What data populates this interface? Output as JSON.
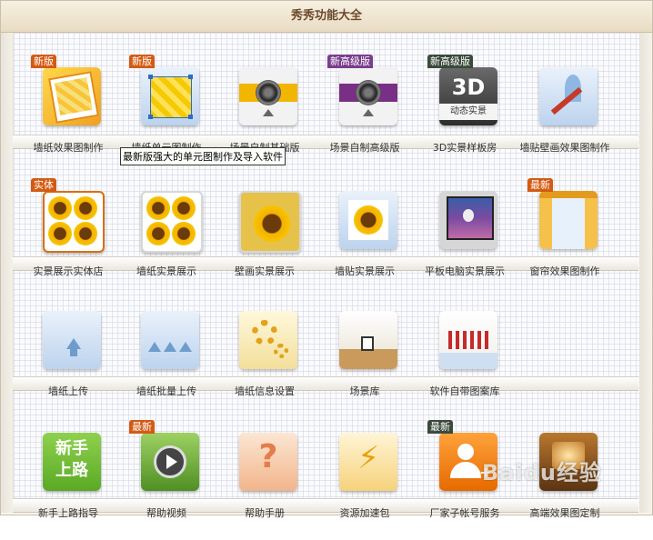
{
  "window": {
    "title": "秀秀功能大全"
  },
  "rows": [
    [
      {
        "label": "墙纸效果图制作",
        "badge": "新版",
        "icon": "wallpaper-effect-icon"
      },
      {
        "label": "墙纸单元图制作",
        "badge": "新版",
        "icon": "wallpaper-unit-icon"
      },
      {
        "label": "场景自制基础版",
        "badge": "",
        "icon": "scene-camera-basic-icon"
      },
      {
        "label": "场景自制高级版",
        "badge": "新高级版",
        "icon": "scene-camera-advanced-icon"
      },
      {
        "label": "3D实景样板房",
        "badge": "新高级版",
        "icon": "3d-showroom-icon"
      },
      {
        "label": "墙贴壁画效果图制作",
        "badge": "",
        "icon": "wall-mural-icon"
      }
    ],
    [
      {
        "label": "实景展示实体店",
        "badge": "实体",
        "icon": "store-display-icon"
      },
      {
        "label": "墙纸实景展示",
        "badge": "",
        "icon": "wallpaper-display-icon"
      },
      {
        "label": "壁画实景展示",
        "badge": "",
        "icon": "mural-display-icon"
      },
      {
        "label": "墙贴实景展示",
        "badge": "",
        "icon": "sticker-display-icon"
      },
      {
        "label": "平板电脑实景展示",
        "badge": "",
        "icon": "tablet-display-icon"
      },
      {
        "label": "窗帘效果图制作",
        "badge": "最新",
        "icon": "curtain-effect-icon"
      }
    ],
    [
      {
        "label": "墙纸上传",
        "badge": "",
        "icon": "wallpaper-upload-icon"
      },
      {
        "label": "墙纸批量上传",
        "badge": "",
        "icon": "batch-upload-icon"
      },
      {
        "label": "墙纸信息设置",
        "badge": "",
        "icon": "settings-gear-icon"
      },
      {
        "label": "场景库",
        "badge": "",
        "icon": "scene-library-icon"
      },
      {
        "label": "软件自带图案库",
        "badge": "",
        "icon": "pattern-library-icon"
      }
    ],
    [
      {
        "label": "新手上路指导",
        "badge": "",
        "icon": "beginner-guide-icon",
        "icon_text": "新手上路"
      },
      {
        "label": "帮助视频",
        "badge": "最新",
        "icon": "help-video-icon"
      },
      {
        "label": "帮助手册",
        "badge": "",
        "icon": "help-manual-icon",
        "icon_text": "?"
      },
      {
        "label": "资源加速包",
        "badge": "",
        "icon": "resource-boost-icon"
      },
      {
        "label": "厂家子帐号服务",
        "badge": "最新",
        "icon": "sub-account-icon"
      },
      {
        "label": "高端效果图定制",
        "badge": "",
        "icon": "premium-render-icon"
      }
    ]
  ],
  "icon3d_text": {
    "big": "3D",
    "small": "动态实景"
  },
  "tooltip": "最新版强大的单元图制作及导入软件",
  "watermark": "Baidu经验"
}
